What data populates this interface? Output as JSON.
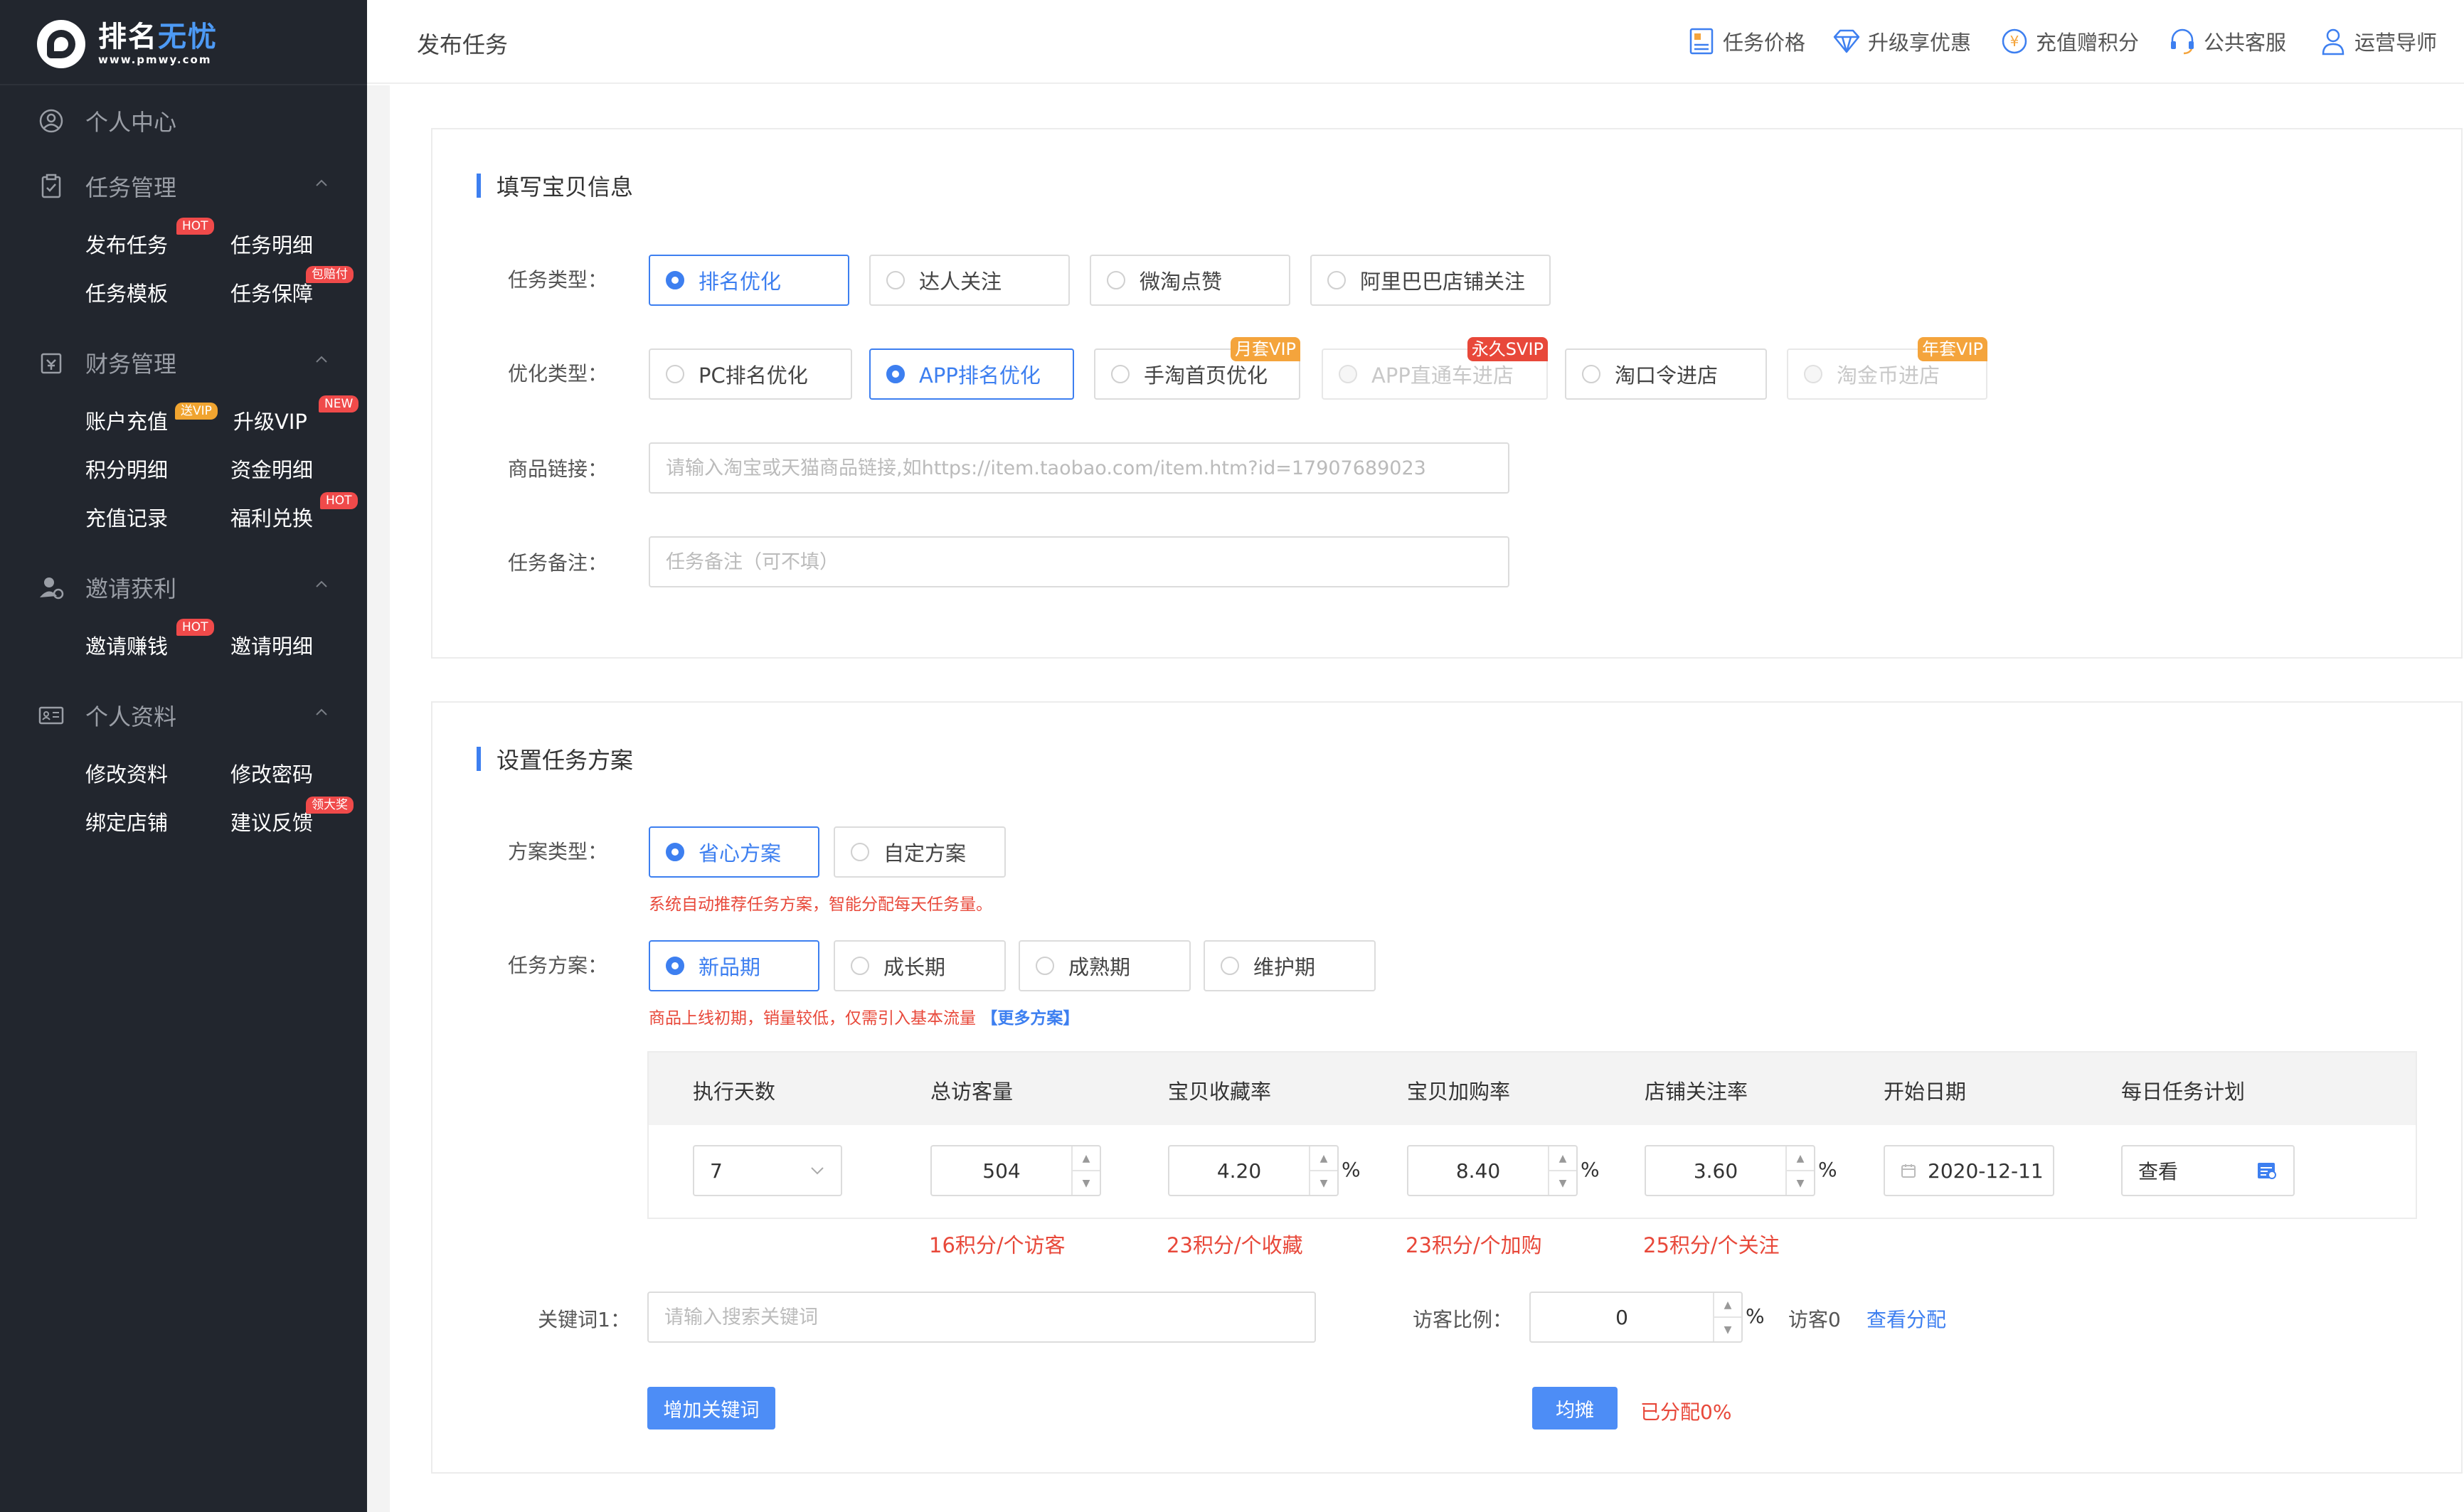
{
  "logo": {
    "title_main": "排名",
    "title_accent": "无忧",
    "subtitle": "www.pmwy.com"
  },
  "sidebar": {
    "groups": [
      {
        "label": "个人中心",
        "icon": "user-circle-icon"
      },
      {
        "label": "任务管理",
        "icon": "clipboard-icon"
      },
      {
        "label": "财务管理",
        "icon": "wallet-icon"
      },
      {
        "label": "邀请获利",
        "icon": "invite-user-icon"
      },
      {
        "label": "个人资料",
        "icon": "id-card-icon"
      }
    ],
    "items": {
      "publish_task": "发布任务",
      "task_detail": "任务明细",
      "task_template": "任务模板",
      "task_guarantee": "任务保障",
      "recharge": "账户充值",
      "upgrade_vip": "升级VIP",
      "points_detail": "积分明细",
      "fund_detail": "资金明细",
      "recharge_record": "充值记录",
      "welfare": "福利兑换",
      "invite_earn": "邀请赚钱",
      "invite_detail": "邀请明细",
      "edit_profile": "修改资料",
      "change_password": "修改密码",
      "bind_shop": "绑定店铺",
      "feedback": "建议反馈"
    },
    "badges": {
      "hot": "HOT",
      "compensate": "包赔付",
      "give_vip": "送VIP",
      "new": "NEW",
      "big_prize": "领大奖"
    }
  },
  "topbar": {
    "title": "发布任务",
    "links": [
      "任务价格",
      "升级享优惠",
      "充值赠积分",
      "公共客服",
      "运营导师"
    ]
  },
  "product_section": {
    "title": "填写宝贝信息",
    "task_type_label": "任务类型：",
    "task_types": [
      "排名优化",
      "达人关注",
      "微淘点赞",
      "阿里巴巴店铺关注"
    ],
    "opt_type_label": "优化类型：",
    "opt_types": [
      "PC排名优化",
      "APP排名优化",
      "手淘首页优化",
      "APP直通车进店",
      "淘口令进店",
      "淘金币进店"
    ],
    "vip_tags": [
      "月套VIP",
      "永久SVIP",
      "年套VIP"
    ],
    "link_label": "商品链接：",
    "link_placeholder": "请输入淘宝或天猫商品链接,如https://item.taobao.com/item.htm?id=17907689023",
    "note_label": "任务备注：",
    "note_placeholder": "任务备注（可不填）"
  },
  "plan_section": {
    "title": "设置任务方案",
    "plan_type_label": "方案类型：",
    "plan_types": [
      "省心方案",
      "自定方案"
    ],
    "plan_type_hint": "系统自动推荐任务方案，智能分配每天任务量。",
    "task_plan_label": "任务方案：",
    "task_plans": [
      "新品期",
      "成长期",
      "成熟期",
      "维护期"
    ],
    "task_plan_hint": "商品上线初期，销量较低，仅需引入基本流量",
    "more_plans": "【更多方案】",
    "table_headers": [
      "执行天数",
      "总访客量",
      "宝贝收藏率",
      "宝贝加购率",
      "店铺关注率",
      "开始日期",
      "每日任务计划"
    ],
    "days": "7",
    "visitors": "504",
    "fav_rate": "4.20",
    "cart_rate": "8.40",
    "follow_rate": "3.60",
    "pct_sign": "%",
    "start_date": "2020-12-11",
    "view_label": "查看",
    "costs": [
      "16积分/个访客",
      "23积分/个收藏",
      "23积分/个加购",
      "25积分/个关注"
    ],
    "keyword_label": "关键词1：",
    "keyword_placeholder": "请输入搜索关键词",
    "visitor_ratio_label": "访客比例：",
    "visitor_ratio": "0",
    "visitor_count": "访客0",
    "view_distribution": "查看分配",
    "add_keyword": "增加关键词",
    "even_split": "均摊",
    "allocated": "已分配0%"
  },
  "colors": {
    "accent": "#3d7ff0",
    "sidebar_bg": "#22262e",
    "warning": "#e8483a",
    "badge_orange": "#f0a430"
  }
}
